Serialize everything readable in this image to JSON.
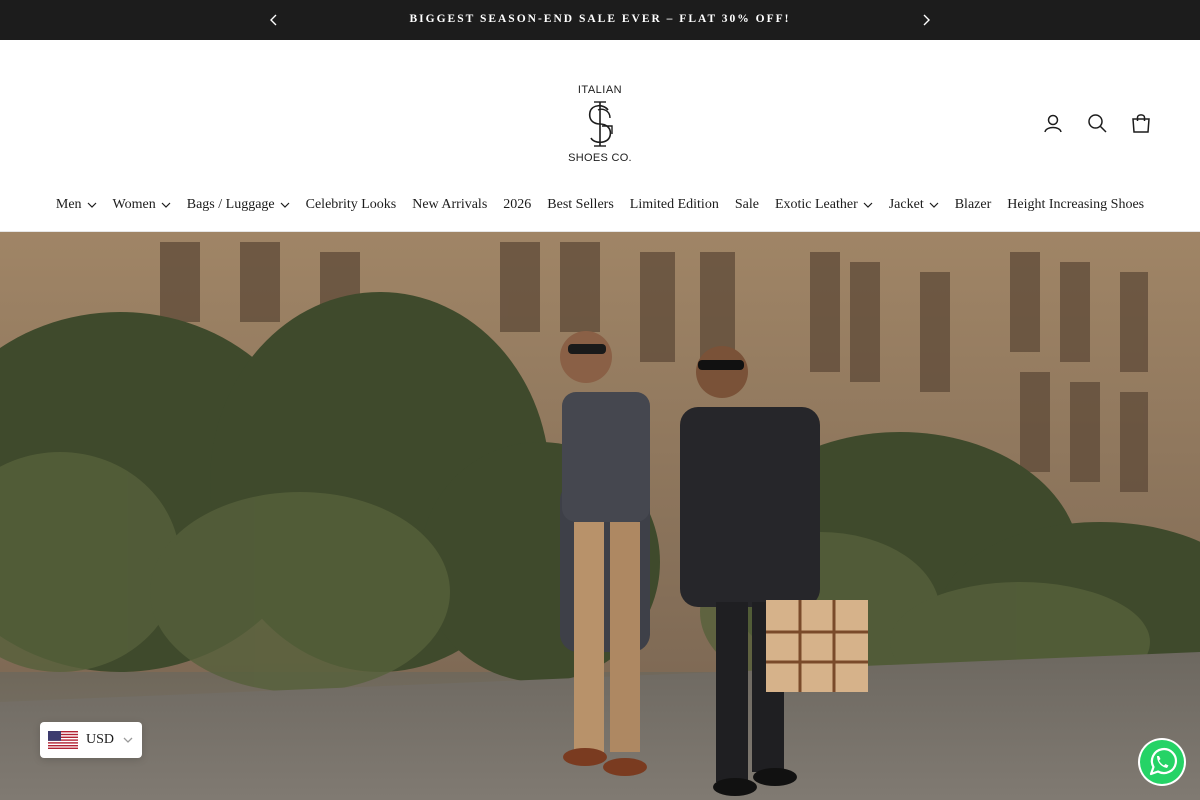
{
  "announcement": {
    "text": "BIGGEST SEASON-END SALE EVER – FLAT 30% OFF!",
    "prev_icon": "chevron-left-icon",
    "next_icon": "chevron-right-icon"
  },
  "logo": {
    "top": "ITALIAN",
    "bottom": "SHOES CO."
  },
  "header_icons": [
    "account-icon",
    "search-icon",
    "cart-icon"
  ],
  "nav": {
    "items": [
      {
        "label": "Men",
        "dropdown": true
      },
      {
        "label": "Women",
        "dropdown": true
      },
      {
        "label": "Bags / Luggage",
        "dropdown": true
      },
      {
        "label": "Celebrity Looks",
        "dropdown": false
      },
      {
        "label": "New Arrivals",
        "dropdown": false
      },
      {
        "label": "2026",
        "dropdown": false
      },
      {
        "label": "Best Sellers",
        "dropdown": false
      },
      {
        "label": "Limited Edition",
        "dropdown": false
      },
      {
        "label": "Sale",
        "dropdown": false
      },
      {
        "label": "Exotic Leather",
        "dropdown": true
      },
      {
        "label": "Jacket",
        "dropdown": true
      },
      {
        "label": "Blazer",
        "dropdown": false
      },
      {
        "label": "Height Increasing Shoes",
        "dropdown": false
      }
    ]
  },
  "currency": {
    "code": "USD",
    "flag_icon": "us-flag-icon"
  },
  "colors": {
    "announcement_bg": "#1c1c1c",
    "text": "#1c1c1c",
    "whatsapp": "#25d366"
  }
}
